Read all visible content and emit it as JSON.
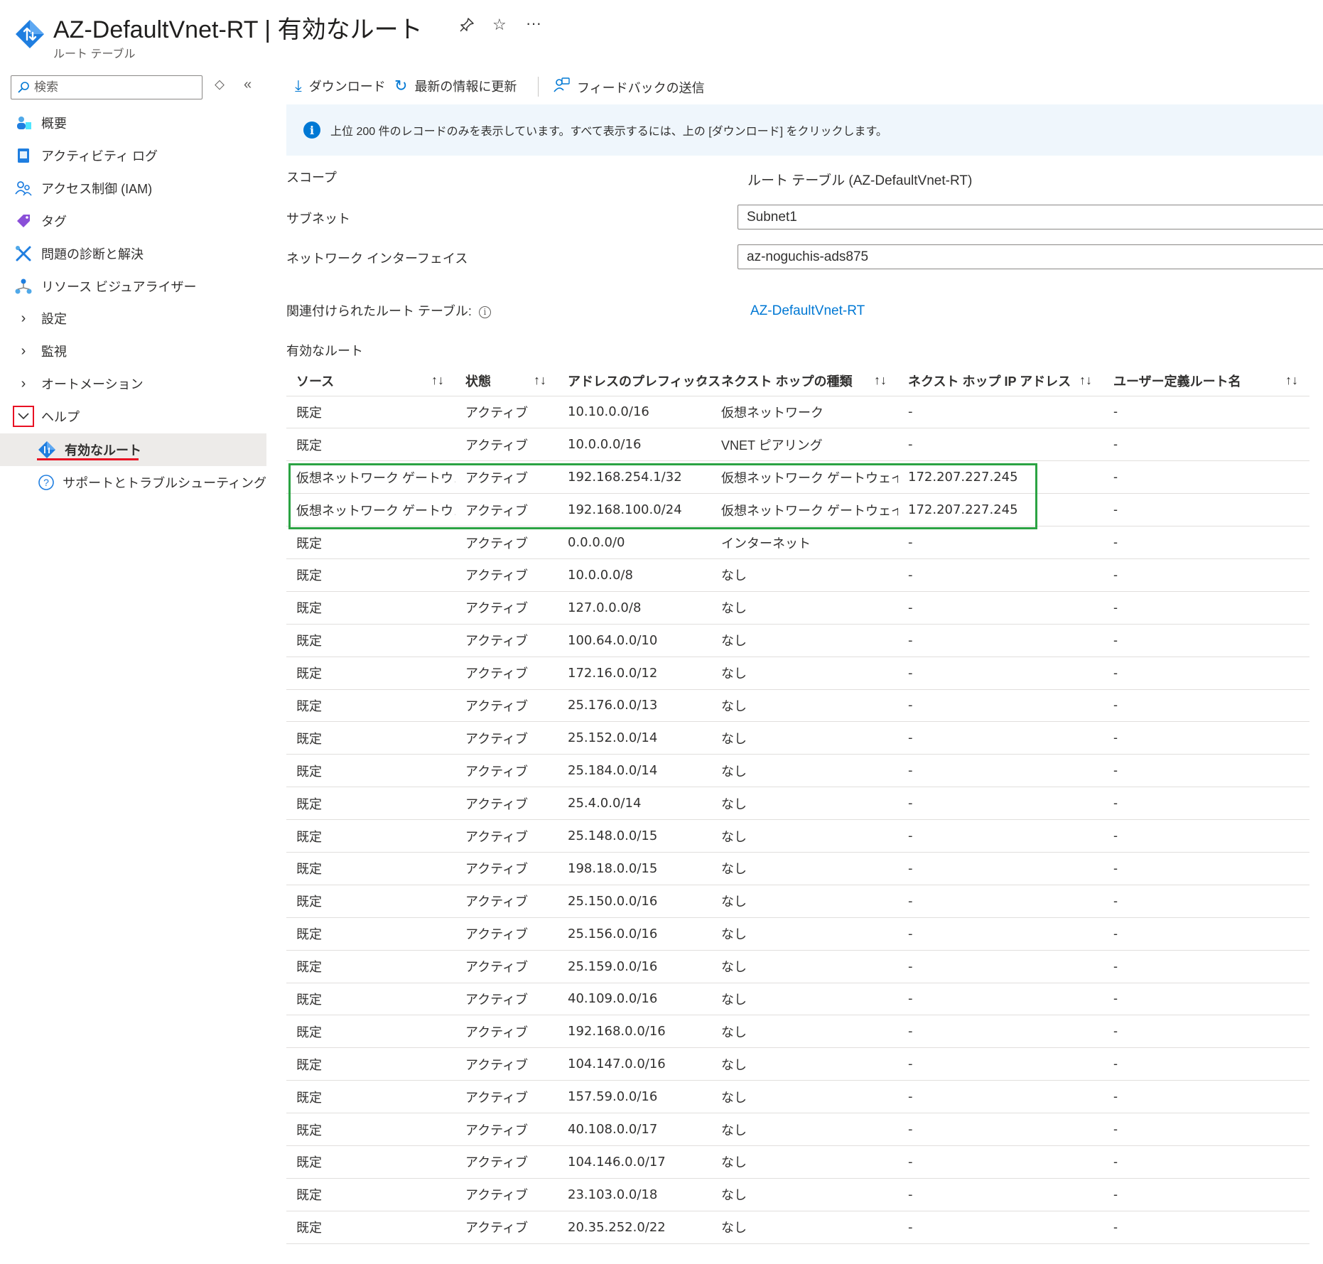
{
  "header": {
    "title": "AZ-DefaultVnet-RT | 有効なルート",
    "subtitle": "ルート テーブル",
    "pin_icon": "pin-icon",
    "favorite_icon": "star-icon",
    "more_icon": "ellipsis-icon"
  },
  "sidebar": {
    "search_placeholder": "検索",
    "items": [
      {
        "label": "概要",
        "icon": "overview-icon"
      },
      {
        "label": "アクティビティ ログ",
        "icon": "activity-log-icon"
      },
      {
        "label": "アクセス制御 (IAM)",
        "icon": "iam-icon"
      },
      {
        "label": "タグ",
        "icon": "tag-icon"
      },
      {
        "label": "問題の診断と解決",
        "icon": "diagnose-icon"
      },
      {
        "label": "リソース ビジュアライザー",
        "icon": "visualizer-icon"
      },
      {
        "label": "設定",
        "icon": "chevron-right-icon"
      },
      {
        "label": "監視",
        "icon": "chevron-right-icon"
      },
      {
        "label": "オートメーション",
        "icon": "chevron-right-icon"
      },
      {
        "label": "ヘルプ",
        "icon": "chevron-down-icon"
      }
    ],
    "sub_items": [
      {
        "label": "有効なルート",
        "icon": "route-table-icon"
      },
      {
        "label": "サポートとトラブルシューティング",
        "icon": "question-icon"
      }
    ]
  },
  "toolbar": {
    "download": "ダウンロード",
    "refresh": "最新の情報に更新",
    "feedback": "フィードバックの送信"
  },
  "info_bar": {
    "text": "上位 200 件のレコードのみを表示しています。すべて表示するには、上の [ダウンロード] をクリックします。"
  },
  "form": {
    "scope_label": "スコープ",
    "scope_value": "ルート テーブル (AZ-DefaultVnet-RT)",
    "subnet_label": "サブネット",
    "subnet_value": "Subnet1",
    "nic_label": "ネットワーク インターフェイス",
    "nic_value": "az-noguchis-ads875",
    "assoc_label": "関連付けられたルート テーブル:",
    "assoc_value": "AZ-DefaultVnet-RT",
    "routes_label": "有効なルート"
  },
  "table": {
    "columns": [
      "ソース",
      "状態",
      "アドレスのプレフィックス",
      "ネクスト ホップの種類",
      "ネクスト ホップ IP アドレス",
      "ユーザー定義ルート名"
    ],
    "sort_glyph": "↑↓",
    "rows": [
      [
        "既定",
        "アクティブ",
        "10.10.0.0/16",
        "仮想ネットワーク",
        "-",
        "-"
      ],
      [
        "既定",
        "アクティブ",
        "10.0.0.0/16",
        "VNET ピアリング",
        "-",
        "-"
      ],
      [
        "仮想ネットワーク ゲートウェイ",
        "アクティブ",
        "192.168.254.1/32",
        "仮想ネットワーク ゲートウェイ",
        "172.207.227.245",
        "-"
      ],
      [
        "仮想ネットワーク ゲートウェイ",
        "アクティブ",
        "192.168.100.0/24",
        "仮想ネットワーク ゲートウェイ",
        "172.207.227.245",
        "-"
      ],
      [
        "既定",
        "アクティブ",
        "0.0.0.0/0",
        "インターネット",
        "-",
        "-"
      ],
      [
        "既定",
        "アクティブ",
        "10.0.0.0/8",
        "なし",
        "-",
        "-"
      ],
      [
        "既定",
        "アクティブ",
        "127.0.0.0/8",
        "なし",
        "-",
        "-"
      ],
      [
        "既定",
        "アクティブ",
        "100.64.0.0/10",
        "なし",
        "-",
        "-"
      ],
      [
        "既定",
        "アクティブ",
        "172.16.0.0/12",
        "なし",
        "-",
        "-"
      ],
      [
        "既定",
        "アクティブ",
        "25.176.0.0/13",
        "なし",
        "-",
        "-"
      ],
      [
        "既定",
        "アクティブ",
        "25.152.0.0/14",
        "なし",
        "-",
        "-"
      ],
      [
        "既定",
        "アクティブ",
        "25.184.0.0/14",
        "なし",
        "-",
        "-"
      ],
      [
        "既定",
        "アクティブ",
        "25.4.0.0/14",
        "なし",
        "-",
        "-"
      ],
      [
        "既定",
        "アクティブ",
        "25.148.0.0/15",
        "なし",
        "-",
        "-"
      ],
      [
        "既定",
        "アクティブ",
        "198.18.0.0/15",
        "なし",
        "-",
        "-"
      ],
      [
        "既定",
        "アクティブ",
        "25.150.0.0/16",
        "なし",
        "-",
        "-"
      ],
      [
        "既定",
        "アクティブ",
        "25.156.0.0/16",
        "なし",
        "-",
        "-"
      ],
      [
        "既定",
        "アクティブ",
        "25.159.0.0/16",
        "なし",
        "-",
        "-"
      ],
      [
        "既定",
        "アクティブ",
        "40.109.0.0/16",
        "なし",
        "-",
        "-"
      ],
      [
        "既定",
        "アクティブ",
        "192.168.0.0/16",
        "なし",
        "-",
        "-"
      ],
      [
        "既定",
        "アクティブ",
        "104.147.0.0/16",
        "なし",
        "-",
        "-"
      ],
      [
        "既定",
        "アクティブ",
        "157.59.0.0/16",
        "なし",
        "-",
        "-"
      ],
      [
        "既定",
        "アクティブ",
        "40.108.0.0/17",
        "なし",
        "-",
        "-"
      ],
      [
        "既定",
        "アクティブ",
        "104.146.0.0/17",
        "なし",
        "-",
        "-"
      ],
      [
        "既定",
        "アクティブ",
        "23.103.0.0/18",
        "なし",
        "-",
        "-"
      ],
      [
        "既定",
        "アクティブ",
        "20.35.252.0/22",
        "なし",
        "-",
        "-"
      ]
    ]
  },
  "colors": {
    "accent": "#0078d4",
    "annotation_red": "#e81123",
    "annotation_green": "#2ba343"
  }
}
